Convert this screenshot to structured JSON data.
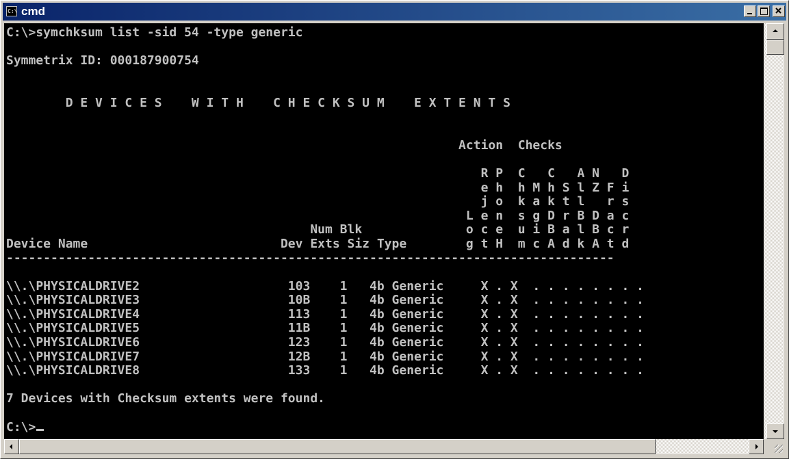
{
  "window": {
    "title": "cmd",
    "icon": "console-icon",
    "icon_text": "C:\\"
  },
  "titlebar_buttons": [
    "minimize-icon",
    "maximize-icon",
    "close-icon"
  ],
  "console": {
    "lines": [
      "C:\\>symchksum list -sid 54 -type generic",
      "",
      "Symmetrix ID: 000187900754",
      "",
      "",
      "        D E V I C E S    W I T H    C H E C K S U M    E X T E N T S",
      "",
      "",
      "                                                             Action  Checks",
      "",
      "                                                                R P  C   C   A N   D",
      "                                                                e h  h M h S l Z F i",
      "                                                                j o  k a k t l   r s",
      "                                                              L e n  s g D r B D a c",
      "                                         Num Blk              o c e  u i B a l B c r",
      "Device Name                          Dev Exts Siz Type        g t H  m c A d k A t d",
      "----------------------------------------------------------------------------------",
      "",
      "\\\\.\\PHYSICALDRIVE2                    103    1   4b Generic     X . X  . . . . . . . .",
      "\\\\.\\PHYSICALDRIVE3                    10B    1   4b Generic     X . X  . . . . . . . .",
      "\\\\.\\PHYSICALDRIVE4                    113    1   4b Generic     X . X  . . . . . . . .",
      "\\\\.\\PHYSICALDRIVE5                    11B    1   4b Generic     X . X  . . . . . . . .",
      "\\\\.\\PHYSICALDRIVE6                    123    1   4b Generic     X . X  . . . . . . . .",
      "\\\\.\\PHYSICALDRIVE7                    12B    1   4b Generic     X . X  . . . . . . . .",
      "\\\\.\\PHYSICALDRIVE8                    133    1   4b Generic     X . X  . . . . . . . .",
      "",
      "7 Devices with Checksum extents were found.",
      "",
      "C:\\>"
    ]
  },
  "colors": {
    "console_bg": "#000000",
    "console_fg": "#c0c0c0",
    "titlebar": "#0a246a"
  }
}
